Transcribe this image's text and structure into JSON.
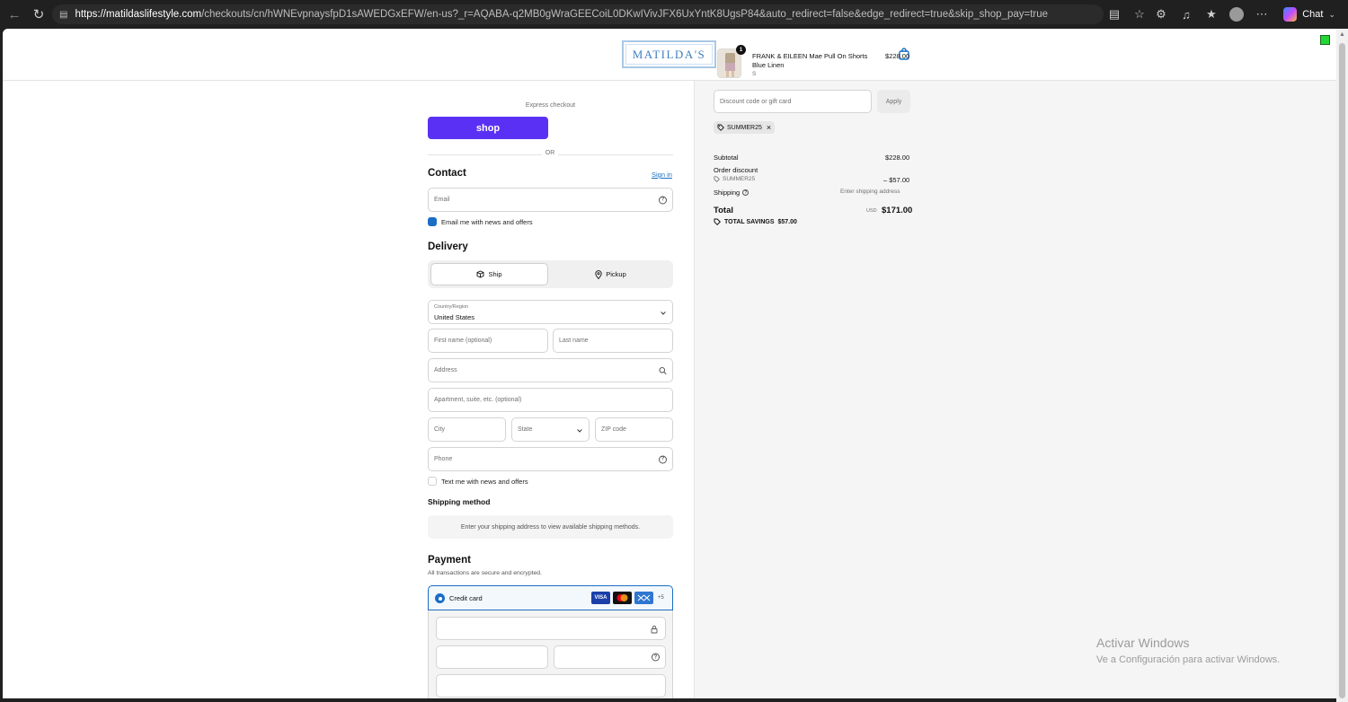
{
  "browser": {
    "url_host": "https://matildaslifestyle.com",
    "url_path": "/checkouts/cn/hWNEvpnaysfpD1sAWEDGxEFW/en-us?_r=AQABA-q2MB0gWraGEECoiL0DKwIVivJFX6UxYntK8UgsP84&auto_redirect=false&edge_redirect=true&skip_shop_pay=true",
    "chat_label": "Chat"
  },
  "header": {
    "logo_text": "MATILDA'S"
  },
  "checkout": {
    "express_label": "Express checkout",
    "shop_button": "shop",
    "or_label": "OR",
    "contact": {
      "title": "Contact",
      "sign_in": "Sign in",
      "email_placeholder": "Email",
      "news_label": "Email me with news and offers"
    },
    "delivery": {
      "title": "Delivery",
      "ship_label": "Ship",
      "pickup_label": "Pickup",
      "country_label": "Country/Region",
      "country_value": "United States",
      "first_name": "First name (optional)",
      "last_name": "Last name",
      "address": "Address",
      "apartment": "Apartment, suite, etc. (optional)",
      "city": "City",
      "state": "State",
      "zip": "ZIP code",
      "phone": "Phone",
      "text_me": "Text me with news and offers"
    },
    "shipping_method": {
      "title": "Shipping method",
      "message": "Enter your shipping address to view available shipping methods."
    },
    "payment": {
      "title": "Payment",
      "subtitle": "All transactions are secure and encrypted.",
      "credit_card": "Credit card",
      "cards": [
        "VISA",
        "MC",
        "AMEX"
      ],
      "more_cards": "+5"
    }
  },
  "summary": {
    "product_name": "FRANK & EILEEN Mae Pull On Shorts Blue Linen",
    "product_variant": "S",
    "product_price": "$228.00",
    "quantity": "1",
    "discount_placeholder": "Discount code or gift card",
    "apply_label": "Apply",
    "applied_code": "SUMMER25",
    "subtotal_label": "Subtotal",
    "subtotal_value": "$228.00",
    "order_discount_label": "Order discount",
    "discount_code": "SUMMER25",
    "discount_value": "– $57.00",
    "shipping_label": "Shipping",
    "shipping_value": "Enter shipping address",
    "total_label": "Total",
    "currency": "USD",
    "total_value": "$171.00",
    "savings_label": "TOTAL SAVINGS",
    "savings_value": "$57.00"
  },
  "watermark": {
    "line1": "Activar Windows",
    "line2": "Ve a Configuración para activar Windows."
  },
  "colors": {
    "shop_purple": "#5a31f4",
    "accent_blue": "#1a6fc4",
    "logo_blue": "#3f7fbf"
  }
}
